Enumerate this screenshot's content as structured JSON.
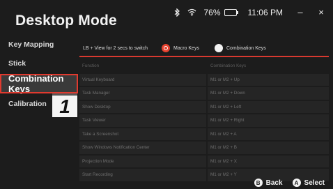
{
  "app": {
    "title": "Desktop Mode"
  },
  "status": {
    "battery_percent": "76%",
    "battery_level": 0.76,
    "time": "11:06 PM",
    "minimize": "–",
    "close": "×"
  },
  "sidebar": {
    "items": [
      {
        "label": "Key Mapping"
      },
      {
        "label": "Stick"
      },
      {
        "label": "Combination Keys",
        "active": true
      },
      {
        "label": "Calibration"
      }
    ]
  },
  "annotation": {
    "badge": "1"
  },
  "options": {
    "hint": "LB + View for 2 secs to switch",
    "macro_label": "Macro Keys",
    "combination_label": "Combination Keys",
    "selected": "macro"
  },
  "table": {
    "headers": [
      "Function",
      "Combination Keys"
    ],
    "rows": [
      [
        "Virtual Keyboard",
        "M1 or M2 + Up"
      ],
      [
        "Task Manager",
        "M1 or M2 + Down"
      ],
      [
        "Show Desktop",
        "M1 or M2 + Left"
      ],
      [
        "Task Viewer",
        "M1 or M2 + Right"
      ],
      [
        "Take a Screenshot",
        "M1 or M2 + A"
      ],
      [
        "Show Windows Notification Center",
        "M1 or M2 + B"
      ],
      [
        "Projection Mode",
        "M1 or M2 + X"
      ],
      [
        "Start Recording",
        "M1 or M2 + Y"
      ]
    ]
  },
  "footer": {
    "back_glyph": "B",
    "back_label": "Back",
    "select_glyph": "A",
    "select_label": "Select"
  },
  "colors": {
    "accent": "#e5422f",
    "background": "#1c1c1c",
    "cell": "#252525"
  }
}
